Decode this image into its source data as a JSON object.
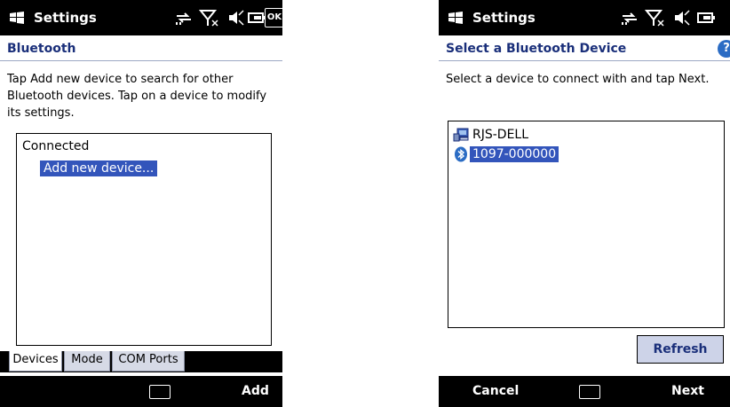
{
  "left": {
    "title": "Settings",
    "ok_label": "OK",
    "header": "Bluetooth",
    "desc_lines": [
      "Tap Add new device to search for other",
      "Bluetooth devices. Tap on a device to modify",
      "its settings."
    ],
    "group_label": "Connected",
    "add_device_label": "Add new device...",
    "tabs": [
      "Devices",
      "Mode",
      "COM Ports"
    ],
    "softkey_right": "Add"
  },
  "right": {
    "title": "Settings",
    "header": "Select a Bluetooth Device",
    "help_label": "?",
    "desc": "Select a device to connect with and tap Next.",
    "devices": [
      {
        "label": "RJS-DELL",
        "icon": "computer-icon",
        "selected": false
      },
      {
        "label": "1097-000000",
        "icon": "bluetooth-icon",
        "selected": true
      }
    ],
    "refresh_label": "Refresh",
    "softkey_left": "Cancel",
    "softkey_right": "Next"
  },
  "colors": {
    "header_text": "#1a2f7a",
    "selection": "#3355bb",
    "tab_inactive": "#d6dae6",
    "button_bg": "#cdd3e8"
  }
}
